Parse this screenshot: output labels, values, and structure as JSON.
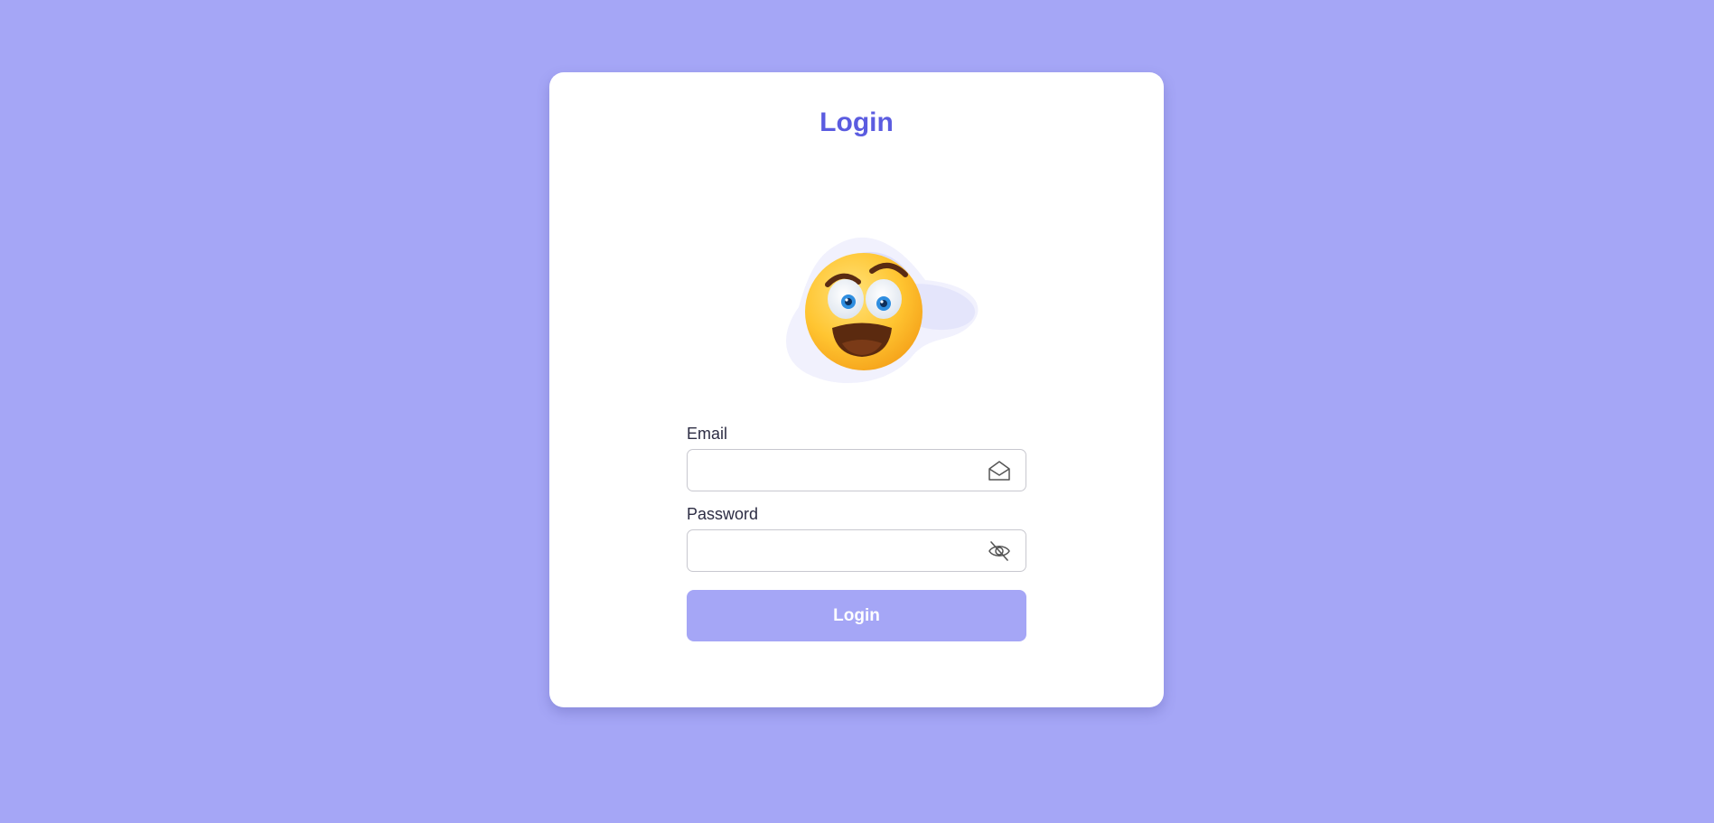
{
  "page": {
    "background_color": "#a5a6f6",
    "accent_color": "#5b5ce0"
  },
  "login_card": {
    "title": "Login",
    "illustration": "surprised-face-emoji",
    "email": {
      "label": "Email",
      "value": "",
      "placeholder": "",
      "icon": "envelope-open-icon"
    },
    "password": {
      "label": "Password",
      "value": "",
      "placeholder": "",
      "icon": "eye-slash-icon"
    },
    "submit": {
      "label": "Login",
      "color": "#a5a6f6"
    }
  }
}
